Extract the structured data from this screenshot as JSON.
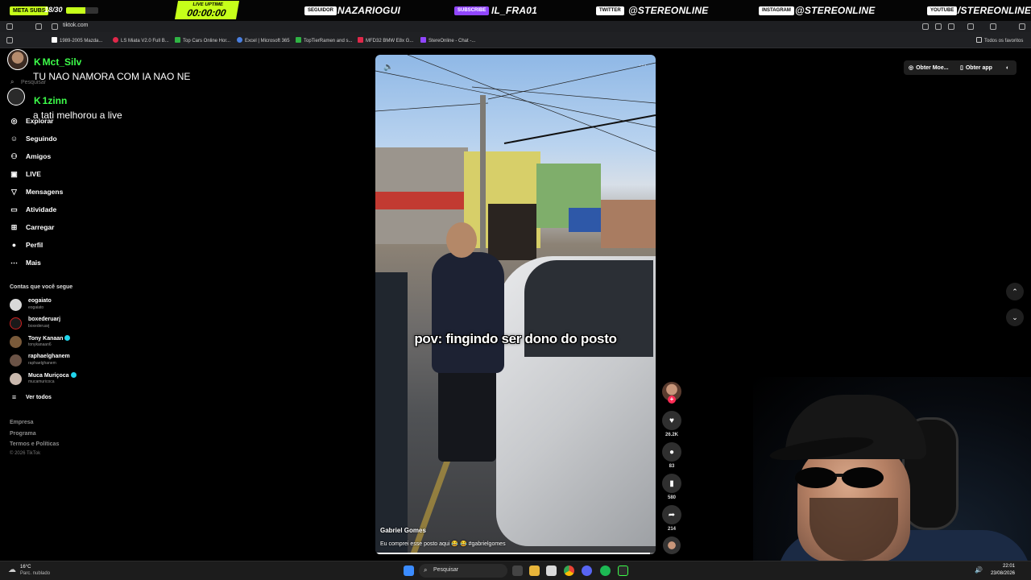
{
  "overlay": {
    "meta_label": "META SUBS",
    "meta_count": "18/30",
    "meta_progress": 0.6,
    "uptime_label": "LIVE UPTIME",
    "uptime_value": "00:00:00",
    "socials": [
      {
        "tag": "SEGUIDOR",
        "value": "NAZARIOGUI"
      },
      {
        "tag": "SUBSCRIBE",
        "value": "IL_FRA01"
      },
      {
        "tag": "TWITTER",
        "value": "@STEREONLINE"
      },
      {
        "tag": "INSTAGRAM",
        "value": "@STEREONLINE"
      },
      {
        "tag": "YOUTUBE",
        "value": "/STEREONLINE"
      }
    ]
  },
  "browser": {
    "url": "tiktok.com",
    "bookmarks": [
      {
        "label": "1989-2005 Mazda...",
        "color": "#ffffff"
      },
      {
        "label": "LS Miata V2.0 Full B...",
        "color": "#e0284a"
      },
      {
        "label": "Top Cars Online Hor...",
        "color": "#2fb344"
      },
      {
        "label": "Excel | Microsoft 365",
        "color": "#4a7fe0"
      },
      {
        "label": "TopTierRamen and s...",
        "color": "#2fb344"
      },
      {
        "label": "MFD32 BMW E8x G...",
        "color": "#e0284a"
      },
      {
        "label": "StereOnline - Chat -...",
        "color": "#9146ff"
      }
    ],
    "bookmarks_folder": "Todos os favoritos"
  },
  "chat": {
    "messages": [
      {
        "user": "Mct_Silv",
        "text": "TU NAO NAMORA COM IA NAO NE"
      },
      {
        "user": "1zinn",
        "text": "a tati melhorou a live"
      }
    ]
  },
  "sidebar": {
    "search_placeholder": "Pesquisar",
    "nav": [
      {
        "label": "Explorar",
        "icon": "compass-icon"
      },
      {
        "label": "Seguindo",
        "icon": "following-icon"
      },
      {
        "label": "Amigos",
        "icon": "friends-icon"
      },
      {
        "label": "LIVE",
        "icon": "live-icon"
      },
      {
        "label": "Mensagens",
        "icon": "messages-icon"
      },
      {
        "label": "Atividade",
        "icon": "activity-icon"
      },
      {
        "label": "Carregar",
        "icon": "upload-icon"
      },
      {
        "label": "Perfil",
        "icon": "profile-icon"
      },
      {
        "label": "Mais",
        "icon": "more-icon"
      }
    ],
    "following_title": "Contas que você segue",
    "following": [
      {
        "name": "eogaiato",
        "handle": "eogaiato",
        "verified": false
      },
      {
        "name": "boxederuarj",
        "handle": "boxederuarj",
        "verified": false
      },
      {
        "name": "Tony Kanaan",
        "handle": "tonykanaan6",
        "verified": true
      },
      {
        "name": "raphaelghanem",
        "handle": "raphaelghanem",
        "verified": false
      },
      {
        "name": "Muca Muriçoca",
        "handle": "mucamuricoca",
        "verified": true
      }
    ],
    "see_all": "Ver todos",
    "footer": [
      "Empresa",
      "Programa",
      "Termos e Políticas"
    ],
    "copyright": "© 2026 TikTok"
  },
  "video": {
    "caption": "pov: fingindo ser dono do posto",
    "author": "Gabriel Gomes",
    "description": "Eu comprei esse posto aqui 😂 😂 #gabrielgomes",
    "progress": 0.98,
    "likes": "26.2K",
    "comments": "83",
    "saves": "580",
    "shares": "214"
  },
  "top_actions": {
    "get_coins": "Obter Moe...",
    "get_app": "Obter app"
  },
  "taskbar": {
    "temp": "16°C",
    "weather": "Parc. nublado",
    "search_label": "Pesquisar",
    "time": "22:01",
    "date": "23/08/2026"
  },
  "colors": {
    "accent_lime": "#c6ff1a",
    "tiktok_red": "#fe2c55",
    "chat_green": "#3dff4a",
    "twitch_purple": "#9146ff"
  }
}
